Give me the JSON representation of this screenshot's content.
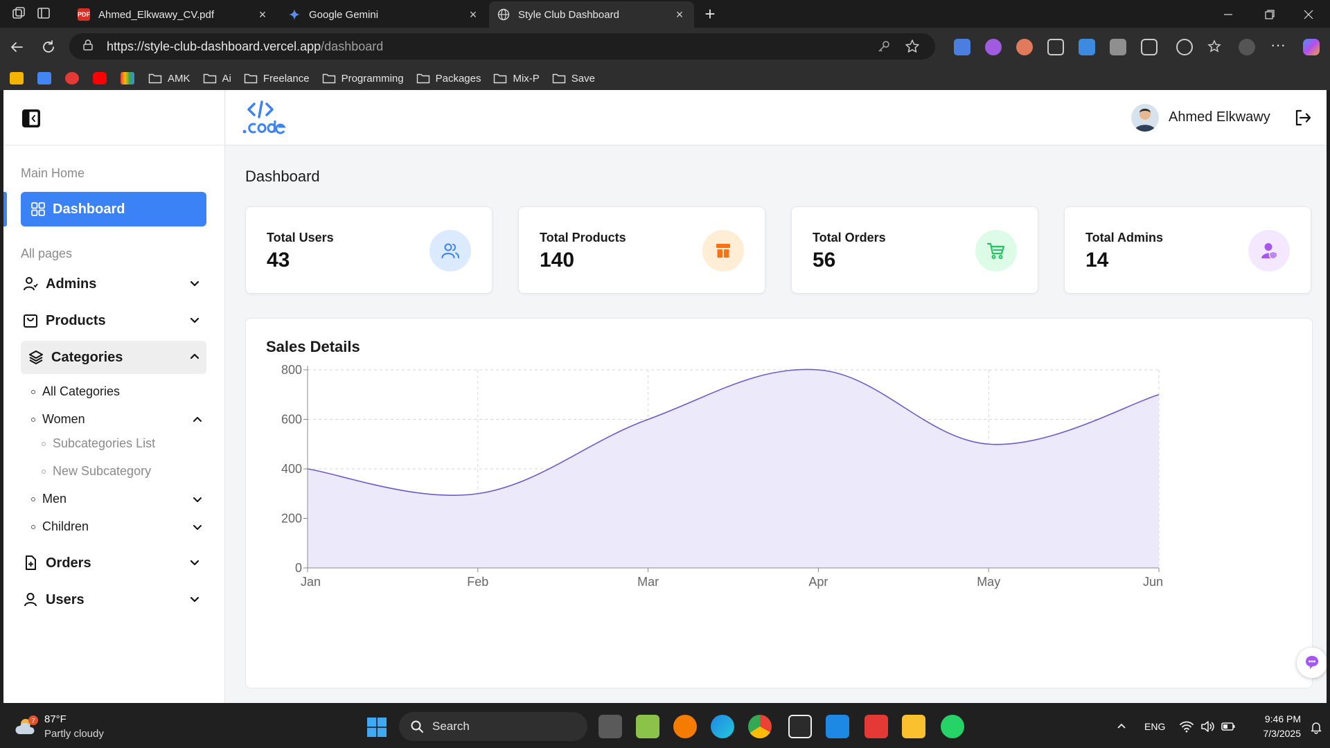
{
  "browser": {
    "tabs": [
      {
        "title": "Ahmed_Elkwawy_CV.pdf",
        "favicon": "PDF",
        "active": false
      },
      {
        "title": "Google Gemini",
        "favicon": "gemini",
        "active": false
      },
      {
        "title": "Style Club Dashboard",
        "favicon": "globe",
        "active": true
      }
    ],
    "url_host": "https://style-club-dashboard.vercel.app",
    "url_path": "/dashboard",
    "bookmarks": [
      "AMK",
      "Ai",
      "Freelance",
      "Programming",
      "Packages",
      "Mix-P",
      "Save"
    ]
  },
  "app": {
    "user": {
      "name": "Ahmed Elkwawy"
    },
    "sidebar": {
      "section_main": "Main Home",
      "dashboard_label": "Dashboard",
      "section_pages": "All pages",
      "items": [
        {
          "label": "Admins",
          "icon": "user-icon"
        },
        {
          "label": "Products",
          "icon": "bag-icon"
        },
        {
          "label": "Categories",
          "icon": "layers-icon"
        },
        {
          "label": "Orders",
          "icon": "file-plus-icon"
        },
        {
          "label": "Users",
          "icon": "user-outline-icon"
        }
      ],
      "categories_sub": {
        "all_categories": "All Categories",
        "women": "Women",
        "subcategories_list": "Subcategories List",
        "new_subcategory": "New Subcategory",
        "men": "Men",
        "children": "Children"
      }
    },
    "page_title": "Dashboard",
    "stats": [
      {
        "label": "Total Users",
        "value": "43",
        "icon": "users-icon",
        "color": "#3b82f6",
        "bg": "#dbeafe"
      },
      {
        "label": "Total Products",
        "value": "140",
        "icon": "box-icon",
        "color": "#f97316",
        "bg": "#ffedd5"
      },
      {
        "label": "Total Orders",
        "value": "56",
        "icon": "cart-icon",
        "color": "#22c55e",
        "bg": "#dcfce7"
      },
      {
        "label": "Total Admins",
        "value": "14",
        "icon": "admin-icon",
        "color": "#a855f7",
        "bg": "#f3e8ff"
      }
    ],
    "sales_title": "Sales Details",
    "chart_data": {
      "type": "area",
      "categories": [
        "Jan",
        "Feb",
        "Mar",
        "Apr",
        "May",
        "Jun"
      ],
      "values": [
        400,
        300,
        600,
        800,
        500,
        700
      ],
      "yticks": [
        0,
        200,
        400,
        600,
        800
      ],
      "ylim": [
        0,
        800
      ],
      "grid": true,
      "line_color": "#6a5acd",
      "fill_color": "#ece9fb"
    }
  },
  "taskbar": {
    "weather_temp": "87°F",
    "weather_cond": "Partly cloudy",
    "weather_badge": "7",
    "search_label": "Search",
    "lang": "ENG",
    "time": "9:46 PM",
    "date": "7/3/2025"
  }
}
